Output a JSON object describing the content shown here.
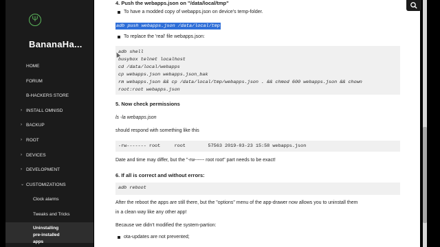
{
  "sidebar": {
    "logo_glyph": "Ψ",
    "brand": "BananaHa...",
    "items": [
      {
        "label": "HOME",
        "chevron": ""
      },
      {
        "label": "FORUM",
        "chevron": ""
      },
      {
        "label": "B-HACKERS STORE",
        "chevron": ""
      },
      {
        "label": "INSTALL OMNISD",
        "chevron": "›"
      },
      {
        "label": "BACKUP",
        "chevron": "›"
      },
      {
        "label": "ROOT",
        "chevron": "›"
      },
      {
        "label": "DEVICES",
        "chevron": "›"
      },
      {
        "label": "DEVELOPMENT",
        "chevron": "›"
      },
      {
        "label": "CUSTOMIZATIONS",
        "chevron": "⌄"
      }
    ],
    "sub_items": [
      "Clock alarms",
      "Tweaks and Tricks"
    ],
    "active_item": "Uninstalling pre-installed apps"
  },
  "content": {
    "step4_heading": "4. Push the webapps.json on \"/data/local/tmp\"",
    "step4_bullet1": "To have a modded copy of webapps.json on device's temp-folder.",
    "step4_command": "adb push webapps.json /data/local/tmp",
    "step4_bullet2": "To replace the 'real' file webapps.json:",
    "step4_code": "adb shell\nbusybox telnet localhost\ncd /data/local/webapps\ncp webapps.json webapps.json_bak\nrm webapps.json && cp /data/local/tmp/webapps.json . && chmod 600 webapps.json && chown\nroot:root webapps.json",
    "step5_heading": "5. Now check permissions",
    "step5_command": "ls -la webapps.json",
    "step5_text": "should respond with something like this",
    "step5_code": "-rw------- root     root        57563 2019-03-23 15:58 webapps.json",
    "step5_note": "Date and time may differ, but the \"-rw------ root     root\" part needs to be exact!",
    "step6_heading": "6. If all is correct and without errors:",
    "step6_code": "adb reboot",
    "step6_text1": "After the reboot the apps are still there, but the \"options\" menu of the app-drawer now allows you to uninstall them",
    "step6_text2": "in a clean way like any other app!",
    "step6_text3": "Because we didn't modified the system-partion:",
    "step6_bullet1": "ota-updates are not prevented;"
  },
  "search_icon": "search-icon"
}
